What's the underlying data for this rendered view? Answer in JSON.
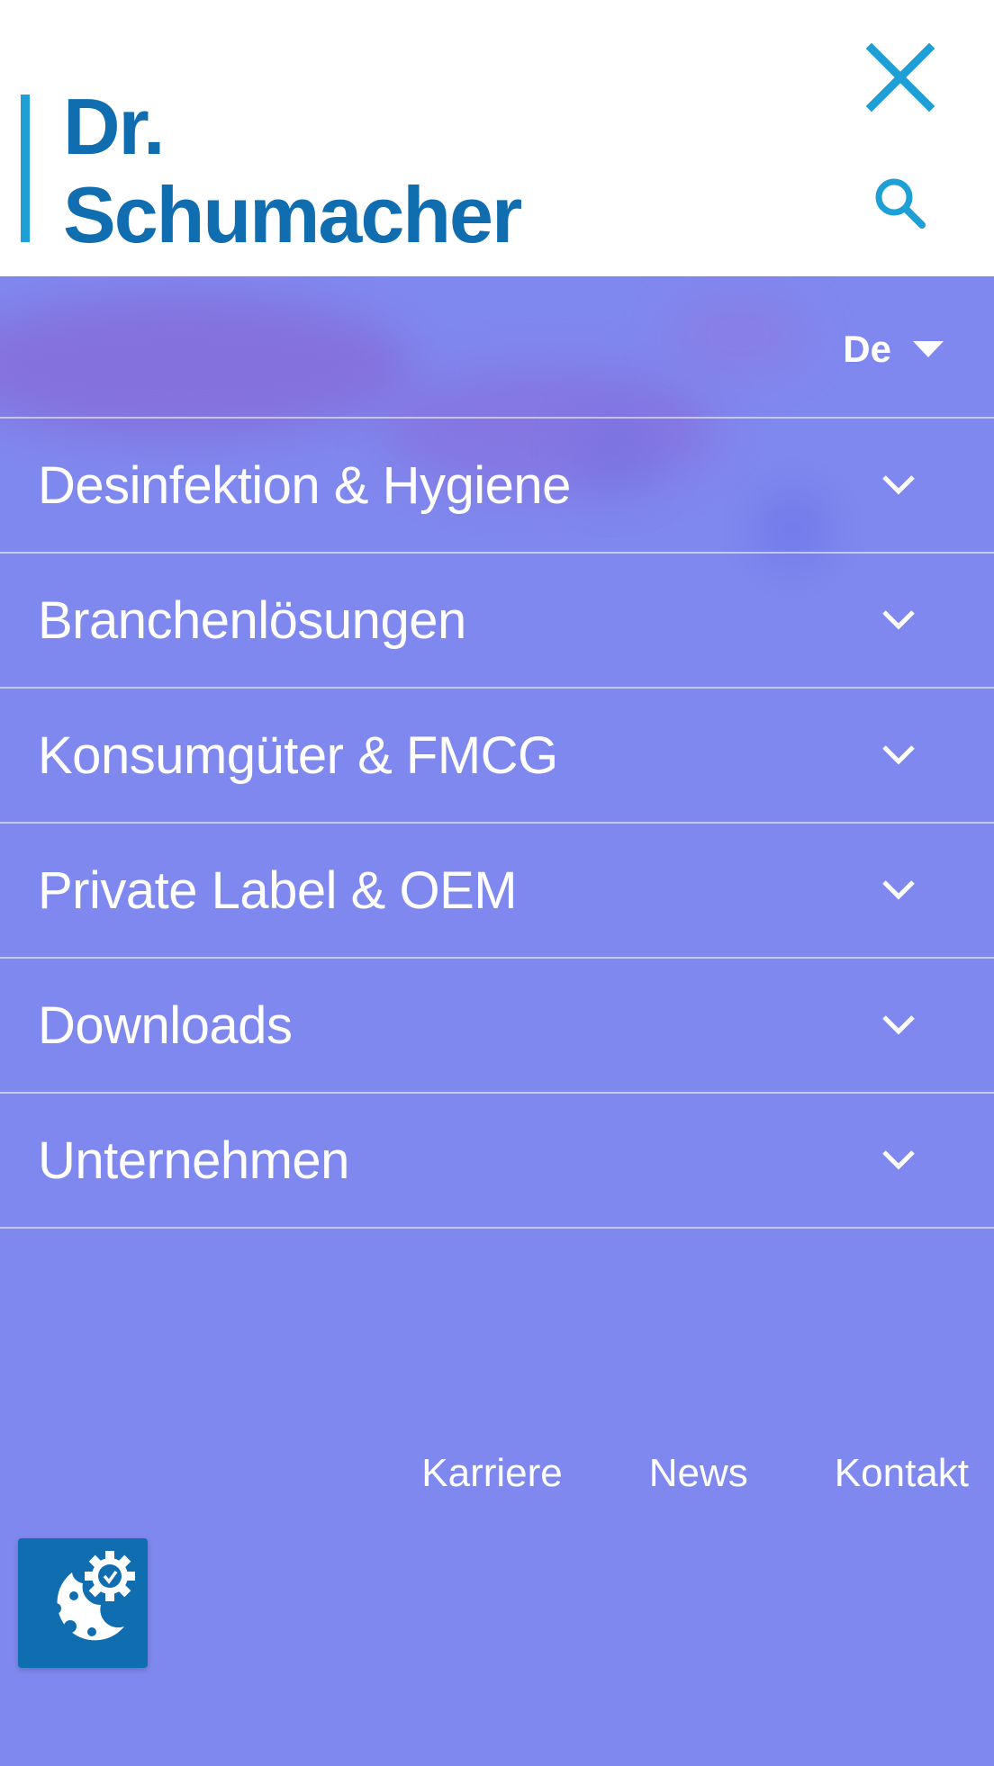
{
  "brand": {
    "logo_line1": "Dr.",
    "logo_line2": "Schumacher",
    "color": "#0f6db0",
    "accent": "#1e9fd6"
  },
  "header": {
    "close_icon": "close-icon",
    "search_icon": "search-icon"
  },
  "language": {
    "selected": "De"
  },
  "menu": {
    "items": [
      {
        "label": "Desinfektion & Hygiene"
      },
      {
        "label": "Branchenlösungen"
      },
      {
        "label": "Konsumgüter & FMCG"
      },
      {
        "label": "Private Label & OEM"
      },
      {
        "label": "Downloads"
      },
      {
        "label": "Unternehmen"
      }
    ],
    "background": "#7f88ee"
  },
  "footer": {
    "links": [
      "Karriere",
      "News",
      "Kontakt"
    ]
  },
  "cookie": {
    "icon": "cookie-settings-icon"
  }
}
